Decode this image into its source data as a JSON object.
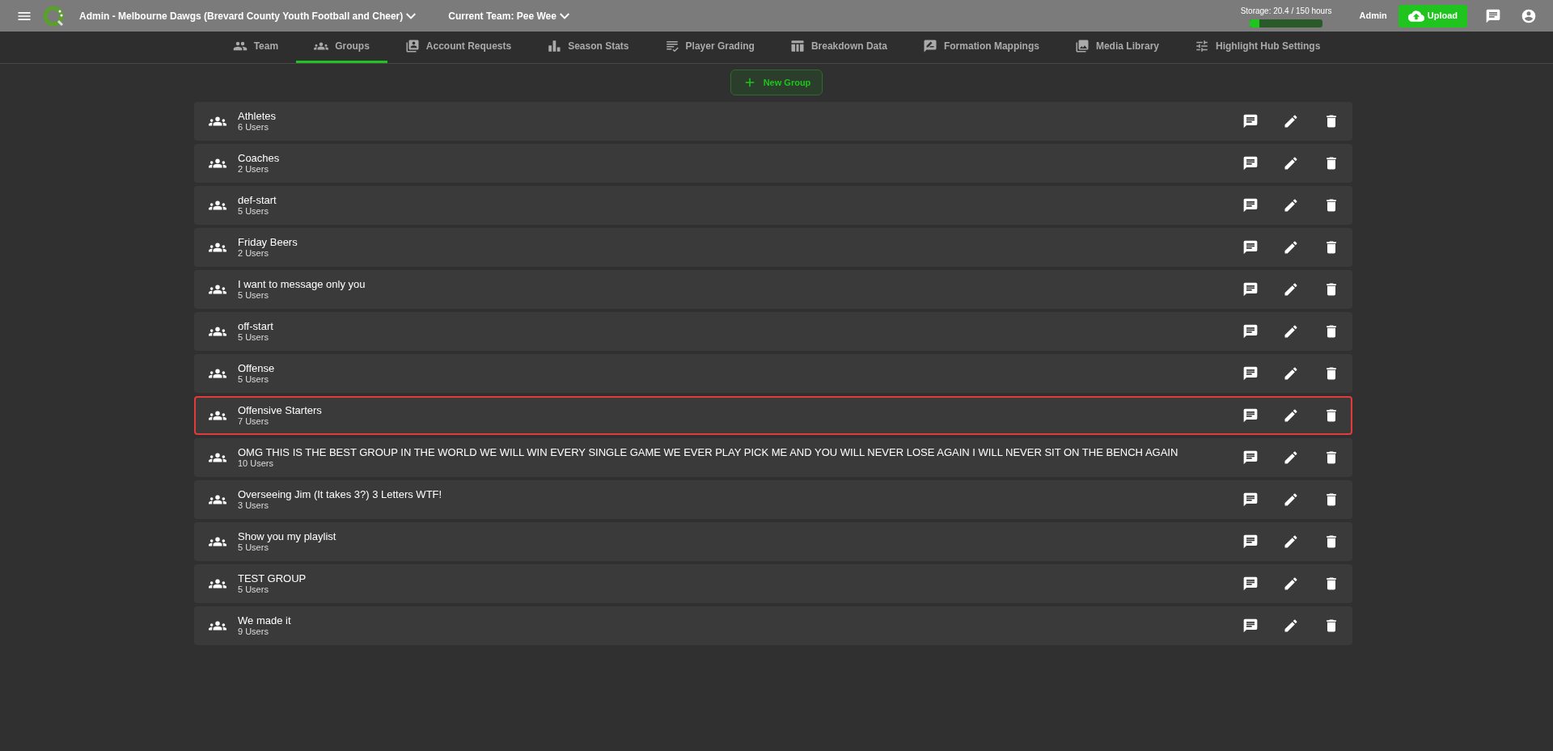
{
  "topbar": {
    "org": "Admin - Melbourne Dawgs (Brevard County Youth Football and Cheer)",
    "team": "Current Team: Pee Wee",
    "storage": {
      "label": "Storage: 20.4 / 150 hours",
      "level": 0.136
    },
    "role": "Admin",
    "upload": "Upload"
  },
  "tabs": [
    {
      "label": "Team",
      "selected": false
    },
    {
      "label": "Groups",
      "selected": true
    },
    {
      "label": "Account Requests",
      "selected": false
    },
    {
      "label": "Season Stats",
      "selected": false
    },
    {
      "label": "Player Grading",
      "selected": false
    },
    {
      "label": "Breakdown Data",
      "selected": false
    },
    {
      "label": "Formation Mappings",
      "selected": false
    },
    {
      "label": "Media Library",
      "selected": false
    },
    {
      "label": "Highlight Hub Settings",
      "selected": false
    }
  ],
  "new_group": "New Group",
  "groups": [
    {
      "name": "Athletes",
      "count": "6 Users",
      "highlighted": false
    },
    {
      "name": "Coaches",
      "count": "2 Users",
      "highlighted": false
    },
    {
      "name": "def-start",
      "count": "5 Users",
      "highlighted": false
    },
    {
      "name": "Friday Beers",
      "count": "2 Users",
      "highlighted": false
    },
    {
      "name": "I want to message only you",
      "count": "5 Users",
      "highlighted": false
    },
    {
      "name": "off-start",
      "count": "5 Users",
      "highlighted": false
    },
    {
      "name": "Offense",
      "count": "5 Users",
      "highlighted": false
    },
    {
      "name": "Offensive Starters",
      "count": "7 Users",
      "highlighted": true
    },
    {
      "name": "OMG THIS IS THE BEST GROUP IN THE WORLD WE WILL WIN EVERY SINGLE GAME WE EVER PLAY PICK ME AND YOU WILL NEVER LOSE AGAIN I WILL NEVER SIT ON THE BENCH AGAIN",
      "count": "10 Users",
      "highlighted": false
    },
    {
      "name": "Overseeing Jim (It takes 3?) 3 Letters WTF!",
      "count": "3 Users",
      "highlighted": false
    },
    {
      "name": "Show you my playlist",
      "count": "5 Users",
      "highlighted": false
    },
    {
      "name": "TEST GROUP",
      "count": "5 Users",
      "highlighted": false
    },
    {
      "name": "We made it",
      "count": "9 Users",
      "highlighted": false
    }
  ]
}
